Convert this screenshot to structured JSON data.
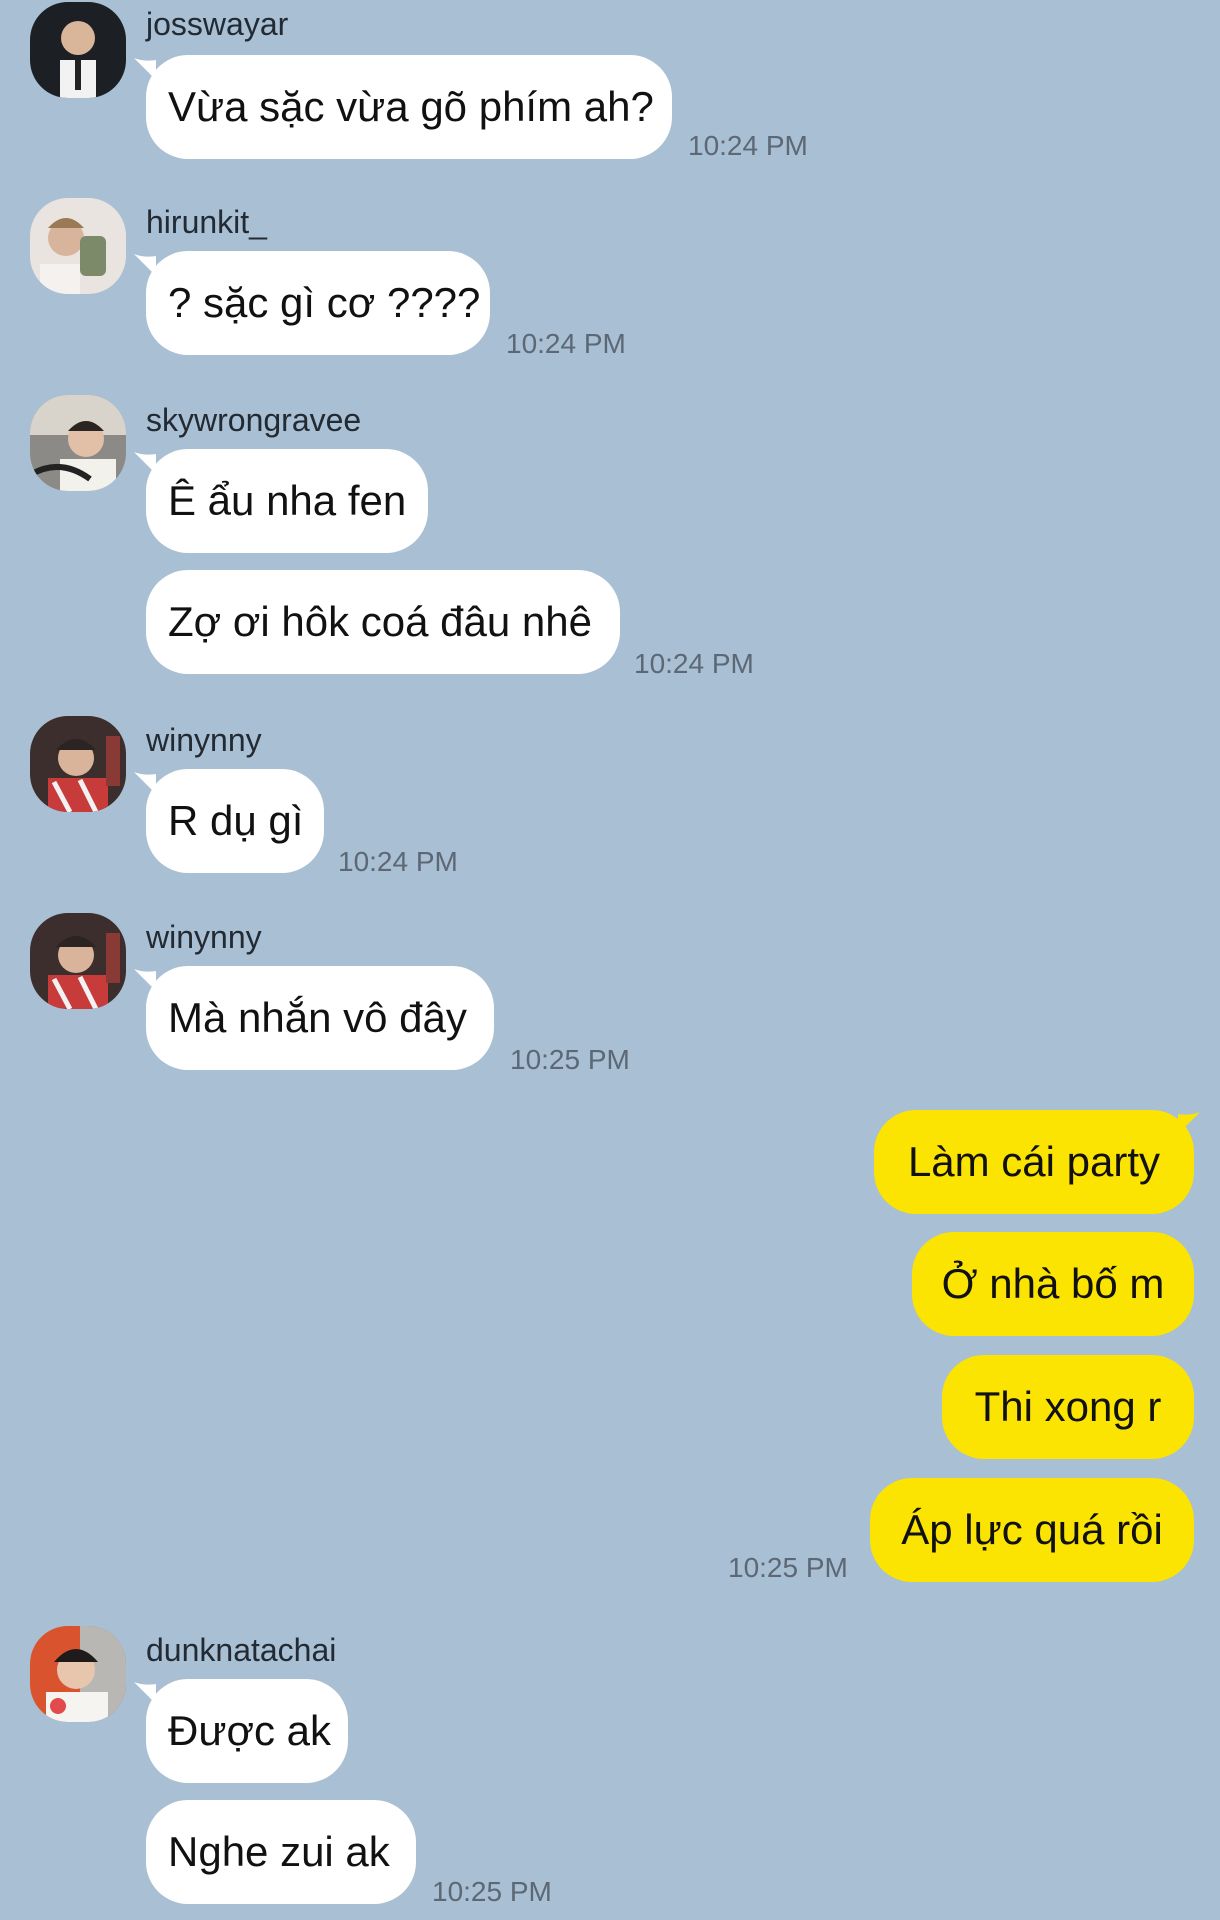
{
  "messages": {
    "m1": {
      "user": "josswayar",
      "text": "Vừa sặc vừa gõ phím ah?",
      "time": "10:24 PM"
    },
    "m2": {
      "user": "hirunkit_",
      "text": "? sặc gì cơ ????",
      "time": "10:24 PM"
    },
    "m3": {
      "user": "skywrongravee",
      "text1": "Ê ẩu nha fen",
      "text2": "Zợ ơi hôk coá đâu nhê",
      "time": "10:24 PM"
    },
    "m4": {
      "user": "winynny",
      "text": "R dụ gì",
      "time": "10:24 PM"
    },
    "m5": {
      "user": "winynny",
      "text": "Mà nhắn vô đây",
      "time": "10:25 PM"
    },
    "mine": {
      "t1": "Làm cái party",
      "t2": "Ở nhà bố m",
      "t3": "Thi xong r",
      "t4": "Áp lực quá rồi",
      "time": "10:25 PM"
    },
    "m6": {
      "user": "dunknatachai",
      "text1": "Được ak",
      "text2": "Nghe zui ak",
      "time": "10:25 PM"
    }
  },
  "colors": {
    "background": "#a9bfd3",
    "incoming_bubble": "#ffffff",
    "outgoing_bubble": "#fbe302"
  },
  "icons": [
    "avatar-josswayar",
    "avatar-hirunkit",
    "avatar-skywrongravee",
    "avatar-winynny",
    "avatar-dunknatachai"
  ]
}
